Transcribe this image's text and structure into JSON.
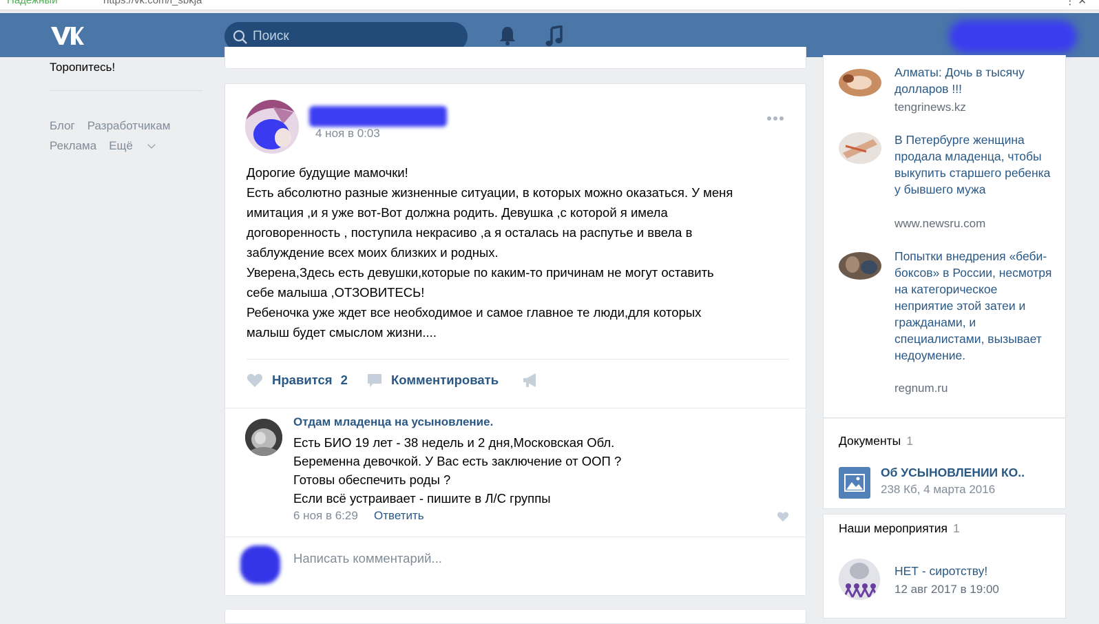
{
  "browser": {
    "crumb": "Надежный",
    "url": "https://vk.com/l_sbkja",
    "window_controls": "⋮ ✕"
  },
  "header": {
    "logo": "vk-logo",
    "search_placeholder": "Поиск",
    "icons": [
      "search-icon",
      "bell-icon",
      "music-note-icon"
    ]
  },
  "left": {
    "text": "Торопитесь!",
    "footer_links": [
      "Блог",
      "Разработчикам",
      "Реклама",
      "Ещё"
    ]
  },
  "post": {
    "date": "4 ноя в 0:03",
    "lines": [
      "Дорогие будущие мамочки!",
      "Есть абсолютно разные жизненные ситуации, в которых можно оказаться. У меня",
      "имитация ,и я уже вот-Вот должна родить. Девушка ,с которой я имела",
      "договоренность , поступила некрасиво ,а я осталась на распутье и ввела в",
      "заблуждение всех моих близких и родных.",
      "Уверена,Здесь есть девушки,которые по каким-то причинам не могут оставить",
      "себе малыша ,ОТЗОВИТЕСЬ!",
      "Ребеночка уже ждет все необходимое и самое главное те люди,для которых",
      "малыш будет смыслом жизни...."
    ],
    "like_label": "Нравится",
    "like_count": "2",
    "comment_label": "Комментировать"
  },
  "comment": {
    "author": "Отдам младенца на усыновление.",
    "lines": [
      "Есть БИО 19 лет -   38 недель и 2 дня,Московская Обл.",
      "Беременна девочкой. У Вас есть заключение от ООП ?",
      "Готовы обеспечить роды ?",
      "Если всё устраивает - пишите в Л/С группы"
    ],
    "date": "6 ноя в 6:29",
    "reply": "Ответить",
    "write_placeholder": "Написать комментарий..."
  },
  "news": [
    {
      "title": "Алматы: Дочь в тысячу долларов !!!",
      "source": "tengrinews.kz"
    },
    {
      "title": "В Петербурге женщина продала младенца, чтобы выкупить старшего ребенка у бывшего мужа",
      "source": "www.newsru.com"
    },
    {
      "title": "Попытки внедрения «беби-боксов» в России, несмотря на категорическое неприятие этой затеи и гражданами, и специалистами, вызывает недоумение.",
      "source": "regnum.ru"
    }
  ],
  "documents": {
    "title": "Документы",
    "count": "1",
    "name": "Об УСЫНОВЛЕНИИ КО..",
    "meta": "238 Кб, 4 марта 2016"
  },
  "events": {
    "title": "Наши мероприятия",
    "count": "1",
    "name": "НЕТ - сиротству!",
    "date": "12 авг 2017 в 19:00"
  },
  "colors": {
    "header": "#4a76a8",
    "link": "#2a5885",
    "muted": "#818c99",
    "background": "#edeef0"
  }
}
